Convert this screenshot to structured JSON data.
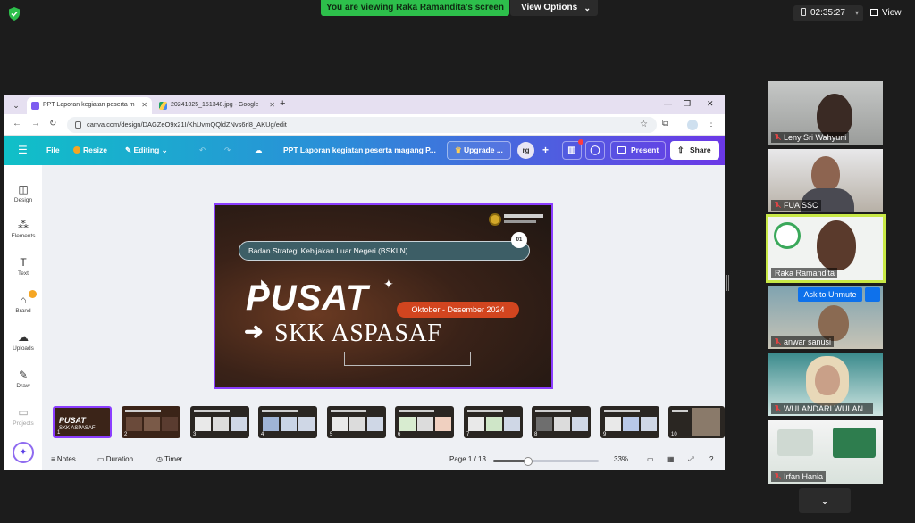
{
  "zoom": {
    "viewing_banner": "You are viewing Raka Ramandita's screen",
    "view_options_label": "View Options",
    "timer": "02:35:27",
    "view_label": "View",
    "ask_to_unmute": "Ask to Unmute",
    "more_label": "...",
    "participants": [
      {
        "name": "Leny Sri Wahyuni"
      },
      {
        "name": "FUA SSC"
      },
      {
        "name": "Raka Ramandita"
      },
      {
        "name": "anwar sanusi"
      },
      {
        "name": "WULANDARI WULAN..."
      },
      {
        "name": "Irfan Hania"
      }
    ]
  },
  "browser": {
    "tabs": [
      {
        "title": "PPT Laporan kegiatan peserta m"
      },
      {
        "title": "20241025_151348.jpg - Google"
      }
    ],
    "url": "canva.com/design/DAGZeO9x21I/KhUvmQQldZNvs6rl8_AKUg/edit"
  },
  "canva": {
    "file": "File",
    "resize": "Resize",
    "editing": "Editing",
    "doc_title": "PPT Laporan kegiatan peserta magang P...",
    "upgrade": "Upgrade ...",
    "avatar_initials": "rg",
    "present": "Present",
    "share": "Share",
    "leftnav": [
      {
        "label": "Design"
      },
      {
        "label": "Elements"
      },
      {
        "label": "Text"
      },
      {
        "label": "Brand"
      },
      {
        "label": "Uploads"
      },
      {
        "label": "Draw"
      },
      {
        "label": "Projects"
      }
    ],
    "slide": {
      "pill_text": "Badan Strategi Kebijakan Luar Negeri (BSKLN)",
      "badge": "01",
      "title_line1": "PUSAT",
      "period": "Oktober - Desember 2024",
      "title_line2": "SKK ASPASAF"
    },
    "thumb_first": {
      "t1": "PUSAT",
      "t2": "SKK ASPASAF"
    },
    "thumb_numbers": [
      "1",
      "2",
      "3",
      "4",
      "5",
      "6",
      "7",
      "8",
      "9",
      "10"
    ],
    "footer": {
      "notes": "Notes",
      "duration": "Duration",
      "timer": "Timer",
      "page": "Page 1 / 13",
      "zoom": "33%",
      "zoom_fraction": 0.33
    }
  }
}
